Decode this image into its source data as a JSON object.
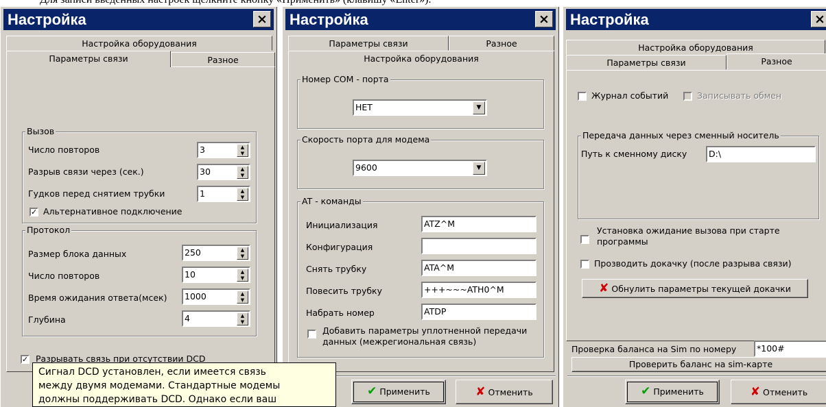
{
  "caption": "Для записи введенных настроек щелкните кнопку «Применить» (клавишу «Enter»).",
  "window_title": "Настройка",
  "close_glyph": "×",
  "tabs": {
    "equipment": "Настройка оборудования",
    "connection": "Параметры связи",
    "misc": "Разное"
  },
  "connection_tab": {
    "call_group": "Вызов",
    "retries_label": "Число повторов",
    "retries_value": "3",
    "disconnect_label": "Разрыв связи через (сек.)",
    "disconnect_value": "30",
    "rings_label": "Гудков перед снятием трубки",
    "rings_value": "1",
    "alt_connect_label": "Альтернативное подключение",
    "protocol_group": "Протокол",
    "block_label": "Размер блока данных",
    "block_value": "250",
    "proto_retries_label": "Число повторов",
    "proto_retries_value": "10",
    "timeout_label": "Время ожидания ответа(мсек)",
    "timeout_value": "1000",
    "depth_label": "Глубина",
    "depth_value": "4",
    "dcd_label": "Разрывать связь при отсутствии DCD"
  },
  "tooltip": {
    "line1": "Сигнал DCD установлен, если имеется связь",
    "line2": "между двумя модемами. Стандартные модемы",
    "line3": "должны поддерживать DCD. Однако если ваш"
  },
  "equipment_tab": {
    "com_group": "Номер COM - порта",
    "com_value": "НЕТ",
    "speed_group": "Скорость порта для модема",
    "speed_value": "9600",
    "at_group": "AT - команды",
    "init_label": "Инициализация",
    "init_value": "ATZ^M",
    "config_label": "Конфигурация",
    "config_value": "",
    "pickup_label": "Снять трубку",
    "pickup_value": "ATA^M",
    "hangup_label": "Повесить трубку",
    "hangup_value": "+++~~~ATH0^M",
    "dial_label": "Набрать номер",
    "dial_value": "ATDP",
    "add_params_line1": "Добавить параметры уплотненной передачи",
    "add_params_line2": "данных (межрегиональная связь)"
  },
  "misc_tab": {
    "log_label": "Журнал событий",
    "record_label": "Записывать обмен",
    "removable_group": "Передача данных через сменный носитель",
    "path_label": "Путь к сменному диску",
    "path_value": "D:\\",
    "wait_call_line1": "Установка ожидание вызова при старте",
    "wait_call_line2": "программы",
    "resume_label": "Прозводить докачку (после разрыва связи)",
    "reset_button": "Обнулить параметры текущей докачки",
    "balance_label": "Проверка баланса на Sim по номеру",
    "balance_value": "*100#",
    "check_balance_button": "Проверить баланс на sim-карте"
  },
  "buttons": {
    "apply": "Применить",
    "cancel": "Отменить"
  },
  "icons": {
    "check_glyph": "✔",
    "x_glyph": "✘",
    "checkbox_mark": "✓",
    "spin_up": "▲",
    "spin_down": "▼",
    "dropdown": "▼"
  }
}
